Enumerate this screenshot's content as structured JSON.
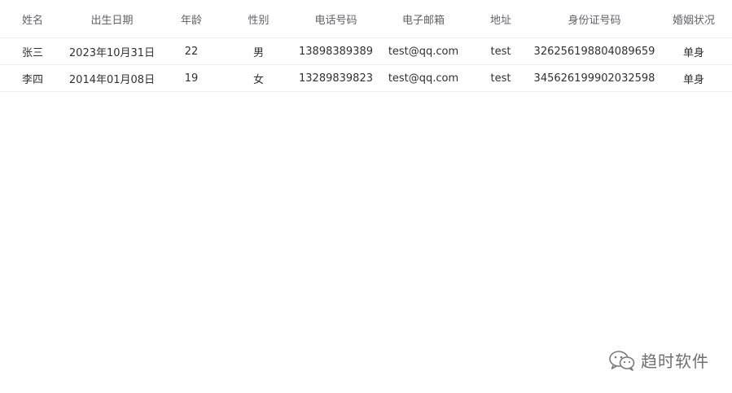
{
  "table": {
    "columns": [
      "姓名",
      "出生日期",
      "年龄",
      "性别",
      "电话号码",
      "电子邮箱",
      "地址",
      "身份证号码",
      "婚姻状况"
    ],
    "rows": [
      [
        "张三",
        "2023年10月31日",
        "22",
        "男",
        "13898389389",
        "test@qq.com",
        "test",
        "326256198804089659",
        "单身"
      ],
      [
        "李四",
        "2014年01月08日",
        "19",
        "女",
        "13289839823",
        "test@qq.com",
        "test",
        "345626199902032598",
        "单身"
      ]
    ]
  },
  "watermark": {
    "icon": "wechat-icon",
    "text": "趋时软件"
  }
}
